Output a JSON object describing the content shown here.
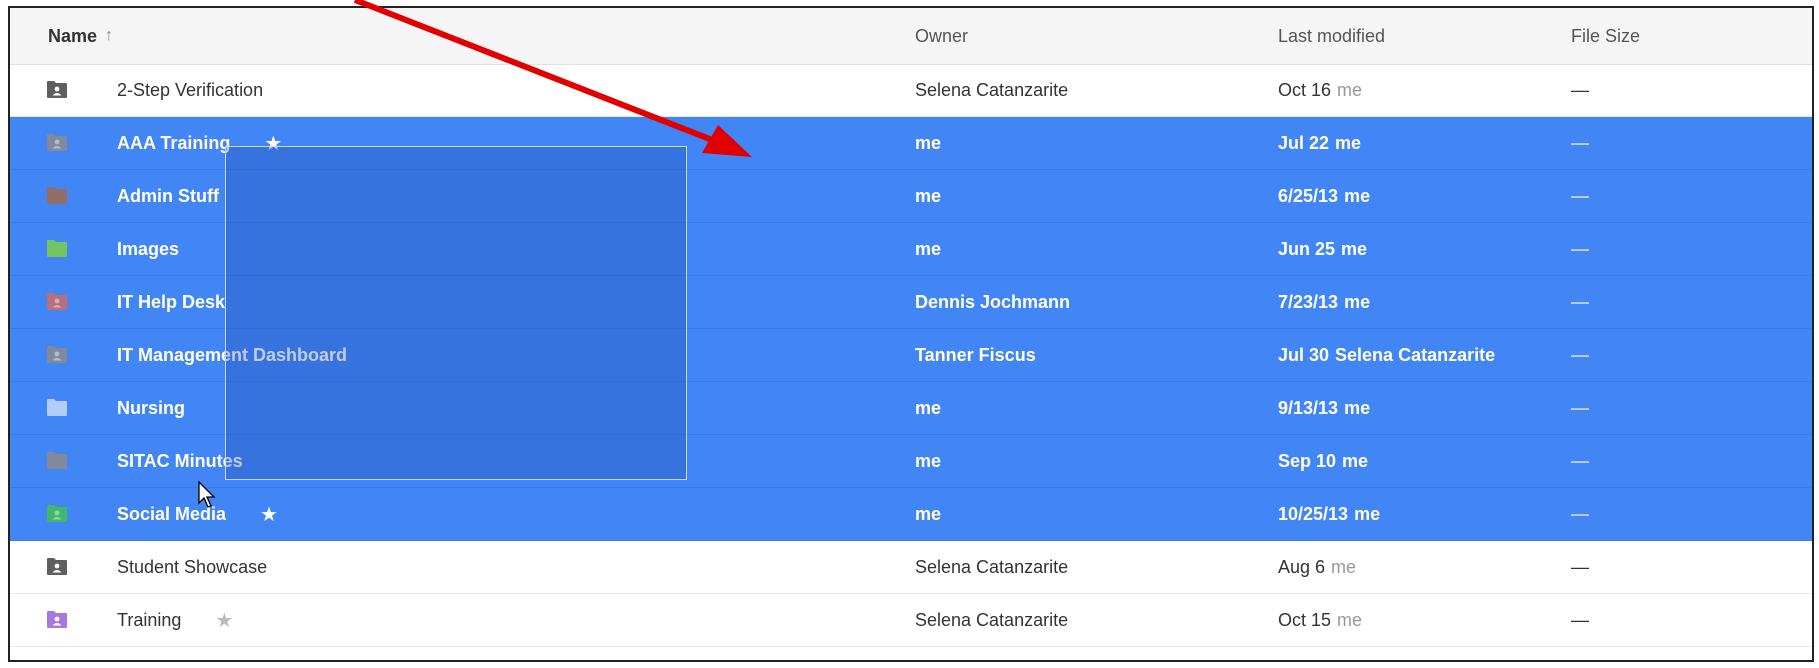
{
  "header": {
    "name_label": "Name",
    "sort_icon": "arrow-up-icon",
    "sort_glyph": "↑",
    "owner_label": "Owner",
    "modified_label": "Last modified",
    "size_label": "File Size"
  },
  "colors": {
    "selection": "#4285f4",
    "annotation_arrow": "#e00000"
  },
  "rows": [
    {
      "name": "2-Step Verification",
      "owner": "Selena Catanzarite",
      "date": "Oct 16",
      "modified_by": "me",
      "size": "—",
      "selected": false,
      "starred": false,
      "icon": "shared-folder-icon",
      "icon_color": "#5f5f5f"
    },
    {
      "name": "AAA Training",
      "owner": "me",
      "date": "Jul 22",
      "modified_by": "me",
      "size": "—",
      "selected": true,
      "starred": true,
      "icon": "shared-folder-icon",
      "icon_color": "#8c8c8c"
    },
    {
      "name": "Admin Stuff",
      "owner": "me",
      "date": "6/25/13",
      "modified_by": "me",
      "size": "—",
      "selected": true,
      "starred": false,
      "icon": "folder-icon",
      "icon_color": "#a06a4a"
    },
    {
      "name": "Images",
      "owner": "me",
      "date": "Jun 25",
      "modified_by": "me",
      "size": "—",
      "selected": true,
      "starred": false,
      "icon": "folder-icon",
      "icon_color": "#7bd148"
    },
    {
      "name": "IT Help Desk",
      "owner": "Dennis Jochmann",
      "date": "7/23/13",
      "modified_by": "me",
      "size": "—",
      "selected": true,
      "starred": false,
      "icon": "shared-folder-icon",
      "icon_color": "#d06b64"
    },
    {
      "name": "IT Management Dashboard",
      "owner": "Tanner Fiscus",
      "date": "Jul 30",
      "modified_by": "Selena Catanzarite",
      "size": "—",
      "selected": true,
      "starred": false,
      "icon": "shared-folder-icon",
      "icon_color": "#8c8c8c"
    },
    {
      "name": "Nursing",
      "owner": "me",
      "date": "9/13/13",
      "modified_by": "me",
      "size": "—",
      "selected": true,
      "starred": false,
      "icon": "folder-icon",
      "icon_color": "#c6dafc"
    },
    {
      "name": "SITAC Minutes",
      "owner": "me",
      "date": "Sep 10",
      "modified_by": "me",
      "size": "—",
      "selected": true,
      "starred": false,
      "icon": "folder-icon",
      "icon_color": "#8c8c8c"
    },
    {
      "name": "Social Media",
      "owner": "me",
      "date": "10/25/13",
      "modified_by": "me",
      "size": "—",
      "selected": true,
      "starred": true,
      "icon": "shared-folder-icon",
      "icon_color": "#42c350"
    },
    {
      "name": "Student Showcase",
      "owner": "Selena Catanzarite",
      "date": "Aug 6",
      "modified_by": "me",
      "size": "—",
      "selected": false,
      "starred": false,
      "icon": "shared-folder-icon",
      "icon_color": "#5f5f5f"
    },
    {
      "name": "Training",
      "owner": "Selena Catanzarite",
      "date": "Oct 15",
      "modified_by": "me",
      "size": "—",
      "selected": false,
      "starred": true,
      "icon": "shared-folder-icon",
      "icon_color": "#a47ae2"
    }
  ]
}
